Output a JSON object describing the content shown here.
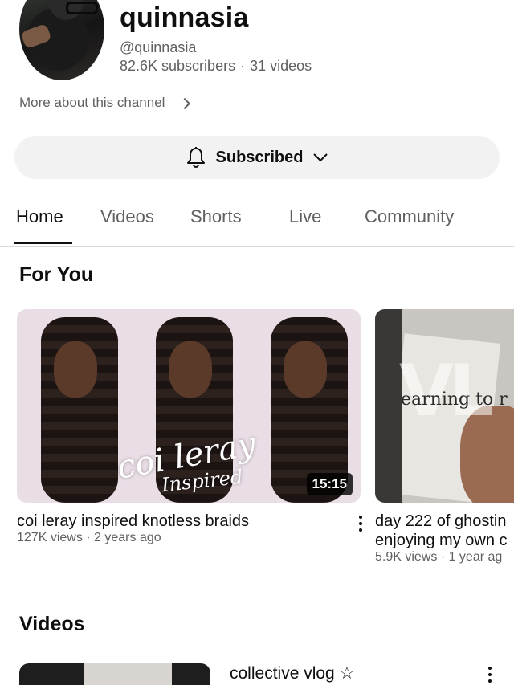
{
  "channel": {
    "name": "quinnasia",
    "handle": "@quinnasia",
    "subscribers": "82.6K subscribers",
    "separator": "·",
    "videos": "31 videos",
    "more_about": "More about this channel"
  },
  "subscribe_button": {
    "label": "Subscribed",
    "icon": "bell-icon",
    "dropdown_icon": "chevron-down-icon"
  },
  "tabs": [
    {
      "label": "Home",
      "active": true
    },
    {
      "label": "Videos",
      "active": false
    },
    {
      "label": "Shorts",
      "active": false
    },
    {
      "label": "Live",
      "active": false
    },
    {
      "label": "Community",
      "active": false
    }
  ],
  "sections": {
    "for_you": "For You",
    "videos": "Videos"
  },
  "for_you_videos": [
    {
      "title": "coi leray inspired knotless braids",
      "meta": "127K views · 2 years ago",
      "duration": "15:15",
      "overlay_line1": "coi leray",
      "overlay_line2": "Inspired"
    },
    {
      "title_line1": "day 222 of ghostin",
      "title_line2": "enjoying my own c",
      "meta": "5.9K views · 1 year ag",
      "overlay_big": "VL",
      "overlay_small": "earning to r"
    }
  ],
  "videos_list": [
    {
      "title": "collective vlog ☆"
    }
  ],
  "colors": {
    "text_primary": "#0f0f0f",
    "text_secondary": "#606060",
    "button_bg": "#f2f2f2",
    "divider": "#d9d9d9"
  }
}
